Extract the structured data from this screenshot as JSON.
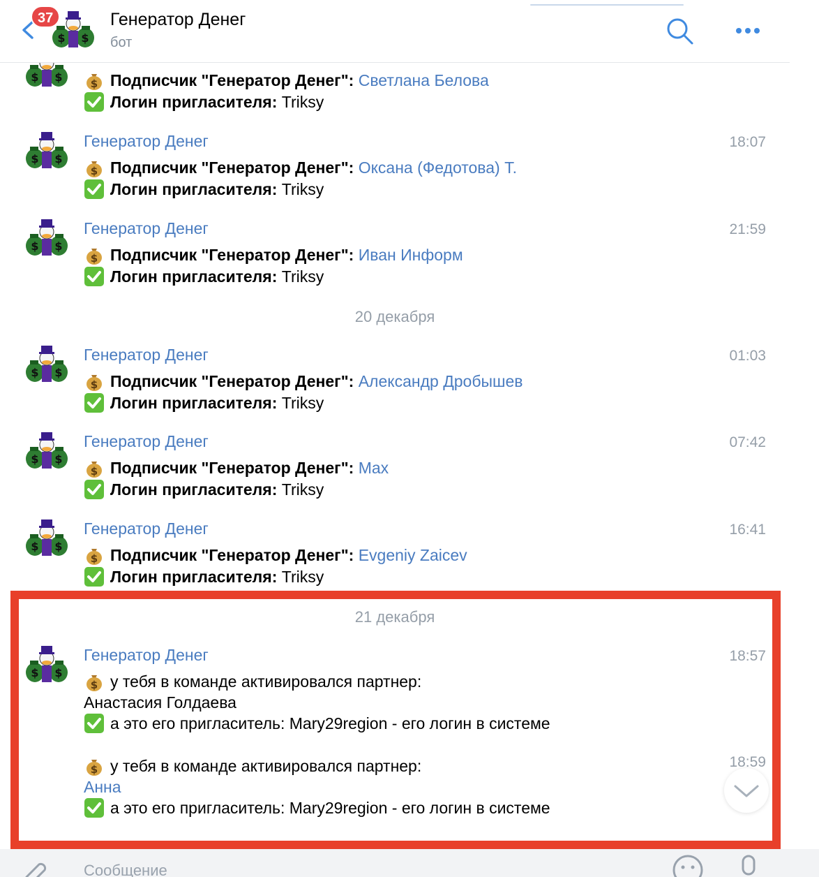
{
  "header": {
    "title": "Генератор Денег",
    "subtitle": "бот",
    "unread_count": "37"
  },
  "composer": {
    "placeholder": "Сообщение"
  },
  "messages": [
    {
      "author": "",
      "time": "",
      "subscriber_label": "Подписчик \"Генератор Денег\":",
      "subscriber": "Светлана Белова",
      "login_label": "Логин пригласителя:",
      "login": "Triksy"
    },
    {
      "author": "Генератор Денег",
      "time": "18:07",
      "subscriber_label": "Подписчик \"Генератор Денег\":",
      "subscriber": "Оксана (Федотова) Т.",
      "login_label": "Логин пригласителя:",
      "login": "Triksy"
    },
    {
      "author": "Генератор Денег",
      "time": "21:59",
      "subscriber_label": "Подписчик \"Генератор Денег\":",
      "subscriber": "Иван Информ",
      "login_label": "Логин пригласителя:",
      "login": "Triksy"
    },
    {
      "author": "Генератор Денег",
      "time": "01:03",
      "subscriber_label": "Подписчик \"Генератор Денег\":",
      "subscriber": "Александр Дробышев",
      "login_label": "Логин пригласителя:",
      "login": "Triksy"
    },
    {
      "author": "Генератор Денег",
      "time": "07:42",
      "subscriber_label": "Подписчик \"Генератор Денег\":",
      "subscriber": "Max",
      "login_label": "Логин пригласителя:",
      "login": "Triksy"
    },
    {
      "author": "Генератор Денег",
      "time": "16:41",
      "subscriber_label": "Подписчик \"Генератор Денег\":",
      "subscriber": "Evgeniy Zaicev",
      "login_label": "Логин пригласителя:",
      "login": "Triksy"
    }
  ],
  "date_separators": [
    "20 декабря",
    "21 декабря"
  ],
  "partner_messages": [
    {
      "author": "Генератор Денег",
      "time": "18:57",
      "activated_text": "у тебя в команде активировался партнер:",
      "partner": "Анастасия Голдаева",
      "inviter_text": "а это его пригласитель: Mary29region - его логин в системе"
    },
    {
      "author": "",
      "time": "18:59",
      "activated_text": "у тебя в команде активировался партнер:",
      "partner": "Анна",
      "inviter_text": "а это его пригласитель: Mary29region - его логин в системе"
    }
  ],
  "colors": {
    "accent": "#4a7cc0",
    "badge": "#e64646",
    "highlight": "#e8402a",
    "secondary": "#959ea8"
  }
}
